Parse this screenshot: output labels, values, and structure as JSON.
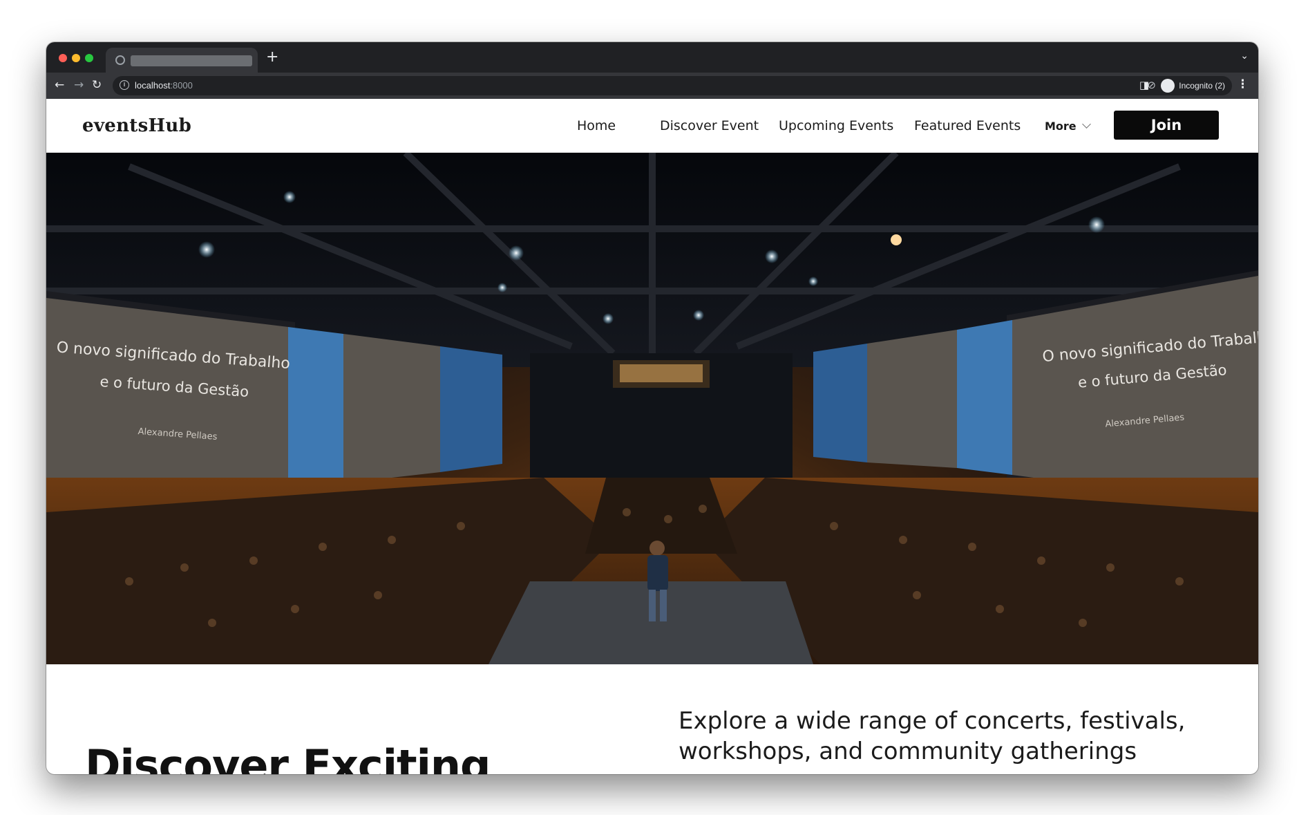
{
  "browser": {
    "new_tab_label": "+",
    "url_host": "localhost",
    "url_port": ":8000",
    "profile_label": "Incognito (2)",
    "icons": [
      "back-icon",
      "forward-icon",
      "reload-icon",
      "info-icon",
      "eye-off-icon",
      "star-icon",
      "sidepanel-icon",
      "incognito-icon",
      "kebab-icon",
      "tab-search-icon"
    ]
  },
  "site": {
    "logo": "eventsHub",
    "nav": [
      {
        "label": "Home"
      },
      {
        "label": "Discover Event"
      },
      {
        "label": "Upcoming Events"
      },
      {
        "label": "Featured Events"
      }
    ],
    "more_label": "More",
    "join_label": "Join"
  },
  "hero": {
    "screen_left_line1": "O novo significado do Trabalho",
    "screen_left_line2": "e o futuro da Gestão",
    "screen_left_name": "Alexandre Pellaes",
    "screen_right_line1": "O novo significado do Trabalho",
    "screen_right_line2": "e o futuro da Gestão",
    "screen_right_name": "Alexandre Pellaes"
  },
  "content": {
    "headline": "Discover Exciting",
    "lede": "Explore a wide range of concerts, festivals, workshops, and community gatherings"
  }
}
